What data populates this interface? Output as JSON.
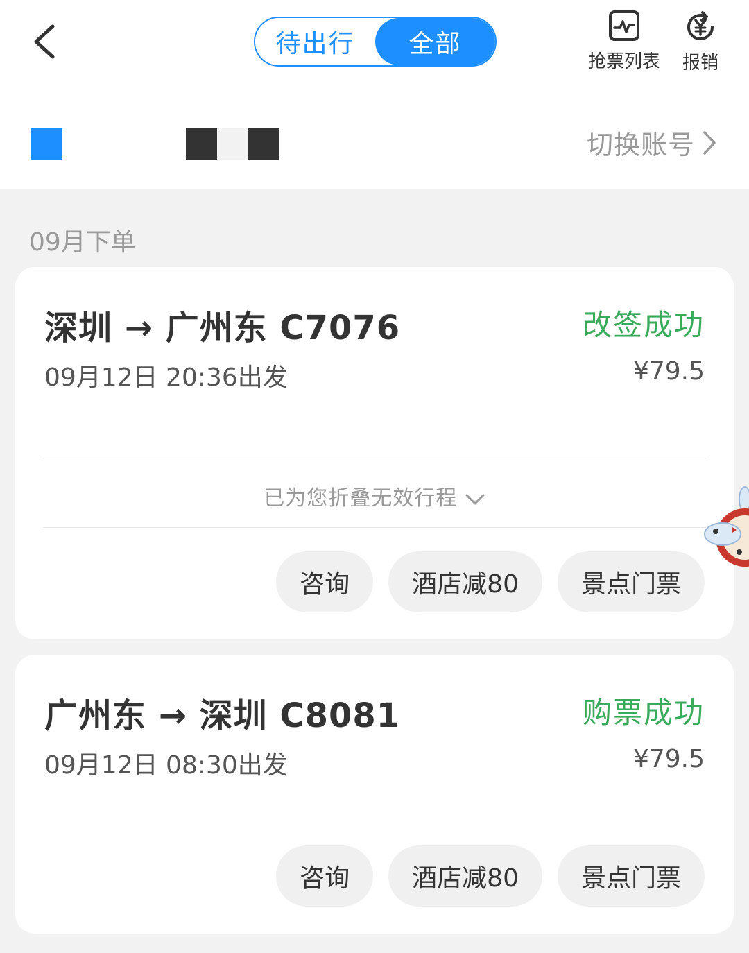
{
  "header": {
    "tabs": [
      {
        "label": "待出行",
        "active": false
      },
      {
        "label": "全部",
        "active": true
      }
    ],
    "actions": [
      {
        "label": "抢票列表",
        "icon": "pulse-chart-icon"
      },
      {
        "label": "报销",
        "icon": "yuan-refund-icon"
      }
    ],
    "switch_account": "切换账号"
  },
  "section": {
    "title": "09月下单"
  },
  "orders": [
    {
      "route": "深圳 → 广州东 C7076",
      "status": "改签成功",
      "departure": "09月12日 20:36出发",
      "price": "¥79.5",
      "fold_text": "已为您折叠无效行程",
      "buttons": [
        "咨询",
        "酒店减80",
        "景点门票"
      ]
    },
    {
      "route": "广州东 → 深圳 C8081",
      "status": "购票成功",
      "departure": "09月12日 08:30出发",
      "price": "¥79.5",
      "buttons": [
        "咨询",
        "酒店减80",
        "景点门票"
      ]
    }
  ],
  "colors": {
    "accent": "#1e8fff",
    "success": "#3aab5a"
  }
}
